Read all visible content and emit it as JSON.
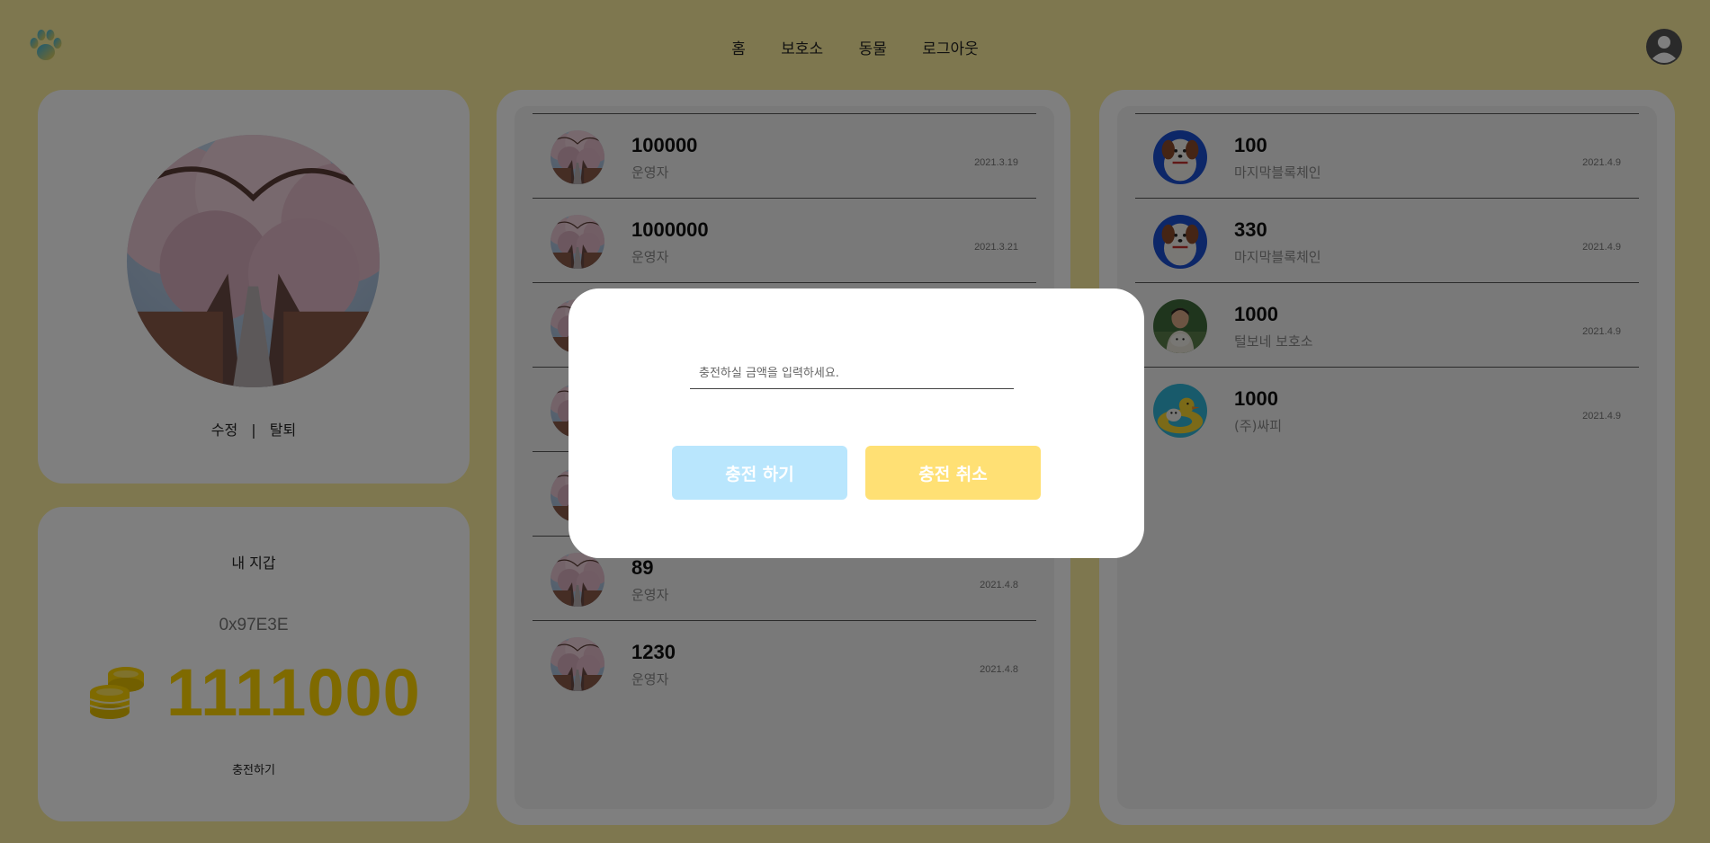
{
  "nav": {
    "items": [
      "홈",
      "보호소",
      "동물",
      "로그아웃"
    ]
  },
  "profile": {
    "edit_label": "수정",
    "separator": "|",
    "withdraw_label": "탈퇴"
  },
  "wallet": {
    "title": "내 지갑",
    "address": "0x97E3E",
    "balance": "1111000",
    "charge_label": "충전하기"
  },
  "middle_list": [
    {
      "amount": "100000",
      "name": "운영자",
      "date": "2021.3.19"
    },
    {
      "amount": "1000000",
      "name": "운영자",
      "date": "2021.3.21"
    },
    {
      "amount": "",
      "name": "",
      "date": ""
    },
    {
      "amount": "",
      "name": "",
      "date": ""
    },
    {
      "amount": "",
      "name": "",
      "date": ""
    },
    {
      "amount": "89",
      "name": "운영자",
      "date": "2021.4.8"
    },
    {
      "amount": "1230",
      "name": "운영자",
      "date": "2021.4.8"
    }
  ],
  "right_list": [
    {
      "amount": "100",
      "name": "마지막블록체인",
      "date": "2021.4.9",
      "avatar": "dog-blue"
    },
    {
      "amount": "330",
      "name": "마지막블록체인",
      "date": "2021.4.9",
      "avatar": "dog-blue"
    },
    {
      "amount": "1000",
      "name": "털보네 보호소",
      "date": "2021.4.9",
      "avatar": "person-dog"
    },
    {
      "amount": "1000",
      "name": "(주)싸피",
      "date": "2021.4.9",
      "avatar": "duck-float"
    }
  ],
  "modal": {
    "input_placeholder": "충전하실 금액을 입력하세요.",
    "input_value": "",
    "confirm_label": "충전 하기",
    "cancel_label": "충전 취소"
  },
  "colors": {
    "background": "#fcef9f",
    "balance": "#ffd400",
    "confirm_button": "#b9e6fd",
    "cancel_button": "#ffe074"
  }
}
